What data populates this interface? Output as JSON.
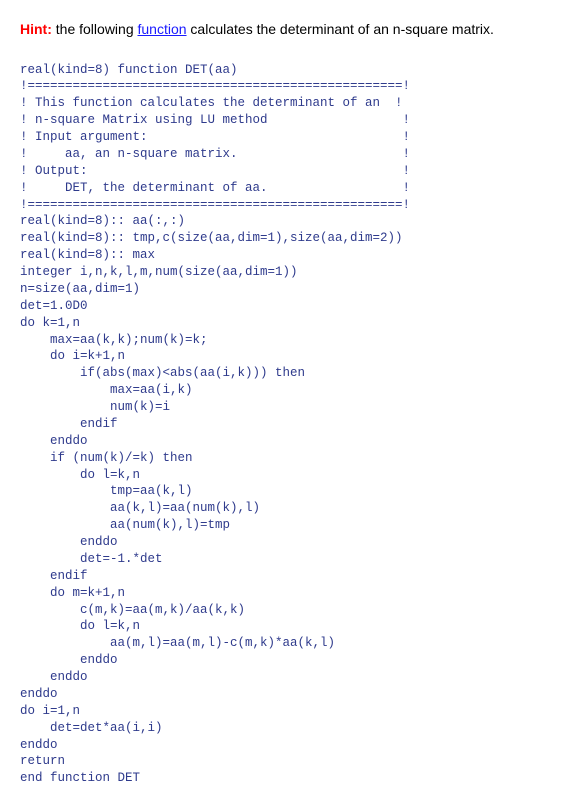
{
  "hint": {
    "label": "Hint:",
    "before_link": " the following ",
    "link_text": "function",
    "after_link": " calculates the determinant of an n-square matrix."
  },
  "code": {
    "lines": [
      "real(kind=8) function DET(aa)",
      "!==================================================!",
      "! This function calculates the determinant of an  !",
      "! n-square Matrix using LU method                  !",
      "! Input argument:                                  !",
      "!     aa, an n-square matrix.                      !",
      "! Output:                                          !",
      "!     DET, the determinant of aa.                  !",
      "!==================================================!",
      "real(kind=8):: aa(:,:)",
      "real(kind=8):: tmp,c(size(aa,dim=1),size(aa,dim=2))",
      "real(kind=8):: max",
      "integer i,n,k,l,m,num(size(aa,dim=1))",
      "n=size(aa,dim=1)",
      "det=1.0D0",
      "do k=1,n",
      "    max=aa(k,k);num(k)=k;",
      "    do i=k+1,n",
      "        if(abs(max)<abs(aa(i,k))) then",
      "            max=aa(i,k)",
      "            num(k)=i",
      "        endif",
      "    enddo",
      "    if (num(k)/=k) then",
      "        do l=k,n",
      "            tmp=aa(k,l)",
      "            aa(k,l)=aa(num(k),l)",
      "            aa(num(k),l)=tmp",
      "        enddo",
      "        det=-1.*det",
      "    endif",
      "    do m=k+1,n",
      "        c(m,k)=aa(m,k)/aa(k,k)",
      "        do l=k,n",
      "            aa(m,l)=aa(m,l)-c(m,k)*aa(k,l)",
      "        enddo",
      "    enddo",
      "enddo",
      "do i=1,n",
      "    det=det*aa(i,i)",
      "enddo",
      "return",
      "end function DET"
    ]
  }
}
